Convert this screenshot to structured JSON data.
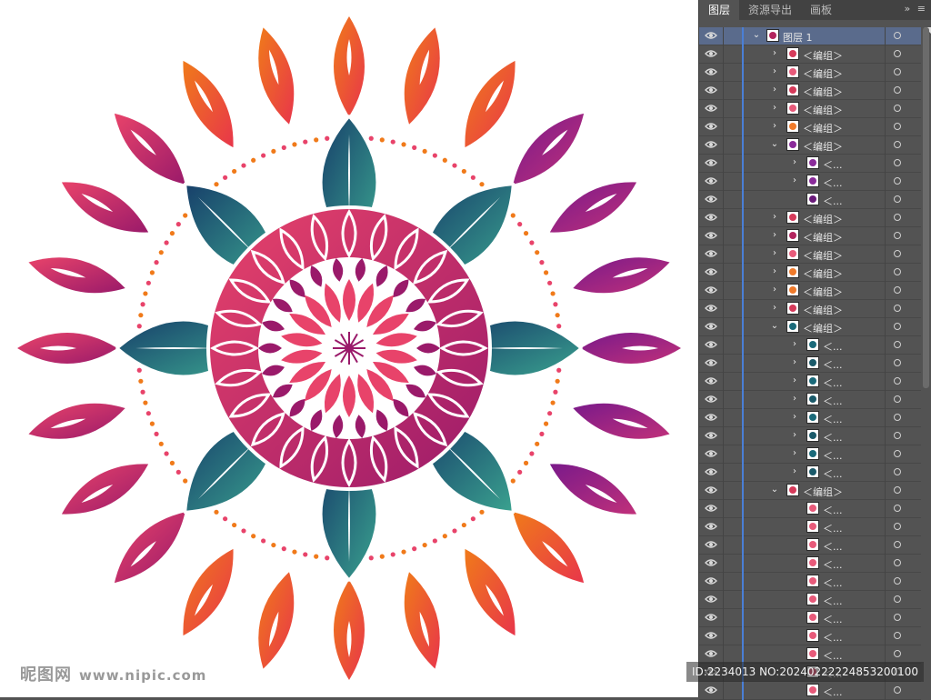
{
  "panel": {
    "tabs": [
      {
        "label": "图层",
        "active": true
      },
      {
        "label": "资源导出",
        "active": false
      },
      {
        "label": "画板",
        "active": false
      }
    ],
    "menu_glyphs": [
      "»",
      "≡"
    ]
  },
  "layers": [
    {
      "indent": 0,
      "expander": "open",
      "label": "图层 1",
      "thumb": "#b3245e",
      "top": true
    },
    {
      "indent": 1,
      "expander": "closed",
      "label": "＜编组＞",
      "thumb": "#d63a5a"
    },
    {
      "indent": 1,
      "expander": "closed",
      "label": "＜编组＞",
      "thumb": "#e85a7a"
    },
    {
      "indent": 1,
      "expander": "closed",
      "label": "＜编组＞",
      "thumb": "#d63a5a"
    },
    {
      "indent": 1,
      "expander": "closed",
      "label": "＜编组＞",
      "thumb": "#e85a7a"
    },
    {
      "indent": 1,
      "expander": "closed",
      "label": "＜编组＞",
      "thumb": "#f07a2a"
    },
    {
      "indent": 1,
      "expander": "open",
      "label": "＜编组＞",
      "thumb": "#8a2a9a"
    },
    {
      "indent": 2,
      "expander": "closed",
      "label": "＜...",
      "thumb": "#8a2a9a"
    },
    {
      "indent": 2,
      "expander": "closed",
      "label": "＜...",
      "thumb": "#8a2a9a"
    },
    {
      "indent": 2,
      "expander": "none",
      "label": "＜...",
      "thumb": "#6a1a7a"
    },
    {
      "indent": 1,
      "expander": "closed",
      "label": "＜编组＞",
      "thumb": "#d63a5a"
    },
    {
      "indent": 1,
      "expander": "closed",
      "label": "＜编组＞",
      "thumb": "#b3245e"
    },
    {
      "indent": 1,
      "expander": "closed",
      "label": "＜编组＞",
      "thumb": "#e85a7a"
    },
    {
      "indent": 1,
      "expander": "closed",
      "label": "＜编组＞",
      "thumb": "#f07a2a"
    },
    {
      "indent": 1,
      "expander": "closed",
      "label": "＜编组＞",
      "thumb": "#f07a2a"
    },
    {
      "indent": 1,
      "expander": "closed",
      "label": "＜编组＞",
      "thumb": "#d63a5a"
    },
    {
      "indent": 1,
      "expander": "open",
      "label": "＜编组＞",
      "thumb": "#1a6a7a"
    },
    {
      "indent": 2,
      "expander": "closed",
      "label": "＜...",
      "thumb": "#1a6a7a"
    },
    {
      "indent": 2,
      "expander": "closed",
      "label": "＜...",
      "thumb": "#1a5a6a"
    },
    {
      "indent": 2,
      "expander": "closed",
      "label": "＜...",
      "thumb": "#1a6a7a"
    },
    {
      "indent": 2,
      "expander": "closed",
      "label": "＜...",
      "thumb": "#1a5a6a"
    },
    {
      "indent": 2,
      "expander": "closed",
      "label": "＜...",
      "thumb": "#1a6a7a"
    },
    {
      "indent": 2,
      "expander": "closed",
      "label": "＜...",
      "thumb": "#1a5a6a"
    },
    {
      "indent": 2,
      "expander": "closed",
      "label": "＜...",
      "thumb": "#1a6a7a"
    },
    {
      "indent": 2,
      "expander": "closed",
      "label": "＜...",
      "thumb": "#1a5a6a"
    },
    {
      "indent": 1,
      "expander": "open",
      "label": "＜编组＞",
      "thumb": "#d63a5a"
    },
    {
      "indent": 2,
      "expander": "none",
      "label": "＜...",
      "thumb": "#e85a7a"
    },
    {
      "indent": 2,
      "expander": "none",
      "label": "＜...",
      "thumb": "#e85a7a"
    },
    {
      "indent": 2,
      "expander": "none",
      "label": "＜...",
      "thumb": "#e85a7a"
    },
    {
      "indent": 2,
      "expander": "none",
      "label": "＜...",
      "thumb": "#e85a7a"
    },
    {
      "indent": 2,
      "expander": "none",
      "label": "＜...",
      "thumb": "#e85a7a"
    },
    {
      "indent": 2,
      "expander": "none",
      "label": "＜...",
      "thumb": "#e85a7a"
    },
    {
      "indent": 2,
      "expander": "none",
      "label": "＜...",
      "thumb": "#e85a7a"
    },
    {
      "indent": 2,
      "expander": "none",
      "label": "＜...",
      "thumb": "#e85a7a"
    },
    {
      "indent": 2,
      "expander": "none",
      "label": "＜...",
      "thumb": "#e85a7a"
    },
    {
      "indent": 2,
      "expander": "none",
      "label": "＜...",
      "thumb": "#e85a7a"
    },
    {
      "indent": 2,
      "expander": "none",
      "label": "＜...",
      "thumb": "#e85a7a"
    }
  ],
  "watermark": {
    "logo": "昵图网",
    "site": "www.nipic.com"
  },
  "image_id": "ID:2234013 NO:20240222224853200100",
  "colors": {
    "teal_dark": "#173f6a",
    "teal_light": "#3aa28f",
    "pink": "#e8436a",
    "magenta": "#9a1a6a",
    "orange": "#f07a1a",
    "purple": "#7a1a8a",
    "selection_row": "#5a6b8c"
  }
}
